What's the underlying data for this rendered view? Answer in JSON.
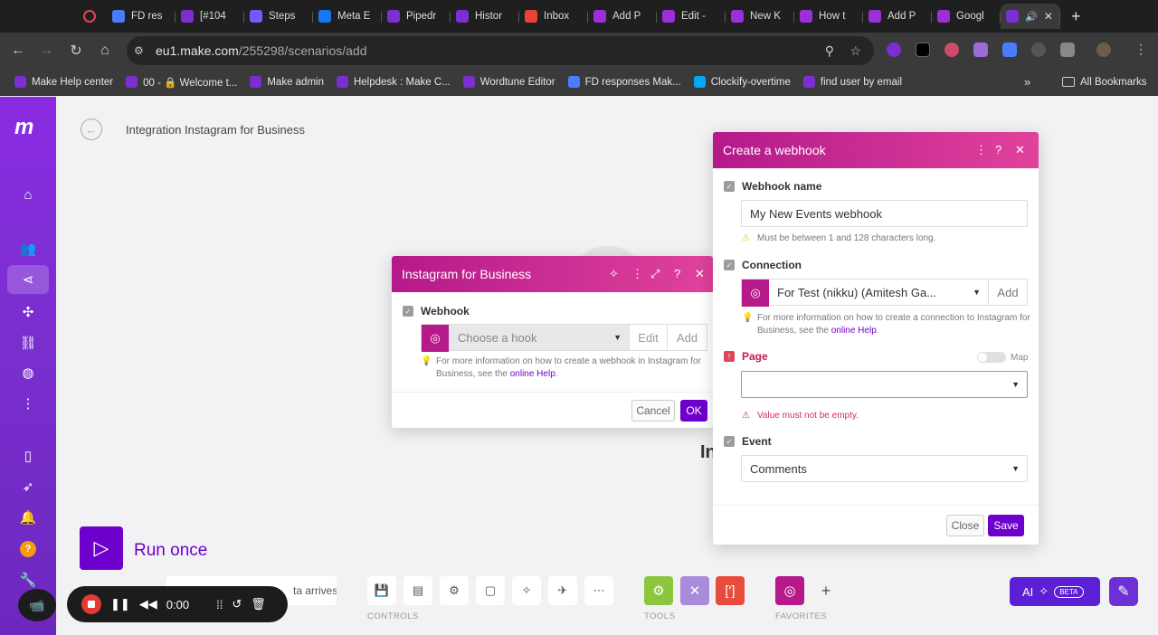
{
  "browser": {
    "tabs": [
      {
        "label": "FD res",
        "color": "#4a7cff"
      },
      {
        "label": "[#104",
        "color": "#7b2fd0"
      },
      {
        "label": "Steps",
        "color": "#6d5cff"
      },
      {
        "label": "Meta E",
        "color": "#1877f2"
      },
      {
        "label": "Pipedr",
        "color": "#7b2fd0"
      },
      {
        "label": "Histor",
        "color": "#7b2fd0"
      },
      {
        "label": "Inbox",
        "color": "#ea4335"
      },
      {
        "label": "Add P",
        "color": "#9b2fd8"
      },
      {
        "label": "Edit - ",
        "color": "#9b2fd8"
      },
      {
        "label": "New K",
        "color": "#9b2fd8"
      },
      {
        "label": "How t",
        "color": "#9b2fd8"
      },
      {
        "label": "Add P",
        "color": "#9b2fd8"
      },
      {
        "label": "Googl",
        "color": "#9b2fd8"
      }
    ],
    "url_host": "eu1.make.com",
    "url_path": "/255298/scenarios/add",
    "bookmarks": [
      {
        "label": "Make Help center",
        "color": "#7b2fd0"
      },
      {
        "label": "00 - 🔒 Welcome t...",
        "color": "#7b2fd0"
      },
      {
        "label": "Make admin",
        "color": "#7b2fd0"
      },
      {
        "label": "Helpdesk : Make C...",
        "color": "#7b2fd0"
      },
      {
        "label": "Wordtune Editor",
        "color": "#7b2fd0"
      },
      {
        "label": "FD responses Mak...",
        "color": "#4a7cff"
      },
      {
        "label": "Clockify-overtime",
        "color": "#03a9f4"
      },
      {
        "label": "find user by email",
        "color": "#7b2fd0"
      }
    ],
    "all_bookmarks": "All Bookmarks"
  },
  "canvas": {
    "title": "Integration Instagram for Business",
    "big_label": "In",
    "run_once": "Run once",
    "schedule_text": "ta arrives.",
    "controls_caption": "CONTROLS",
    "tools_caption": "TOOLS",
    "favorites_caption": "FAVORITES",
    "ai_label": "AI",
    "beta": "BETA"
  },
  "recorder": {
    "time": "0:00"
  },
  "ig_modal": {
    "title": "Instagram for Business",
    "field_label": "Webhook",
    "select_placeholder": "Choose a hook",
    "edit": "Edit",
    "add": "Add",
    "hint": "For more information on how to create a webhook in Instagram for Business, see the",
    "hint_link": "online Help",
    "cancel": "Cancel",
    "ok": "OK"
  },
  "webhook_modal": {
    "title": "Create a webhook",
    "name_label": "Webhook name",
    "name_value": "My New Events webhook",
    "name_hint": "Must be between 1 and 128 characters long.",
    "connection_label": "Connection",
    "connection_value": "For Test (nikku) (Amitesh Ga...",
    "connection_add": "Add",
    "connection_hint": "For more information on how to create a connection to Instagram for Business, see the",
    "connection_link": "online Help",
    "page_label": "Page",
    "map_label": "Map",
    "page_error": "Value must not be empty.",
    "event_label": "Event",
    "event_value": "Comments",
    "close": "Close",
    "save": "Save"
  }
}
